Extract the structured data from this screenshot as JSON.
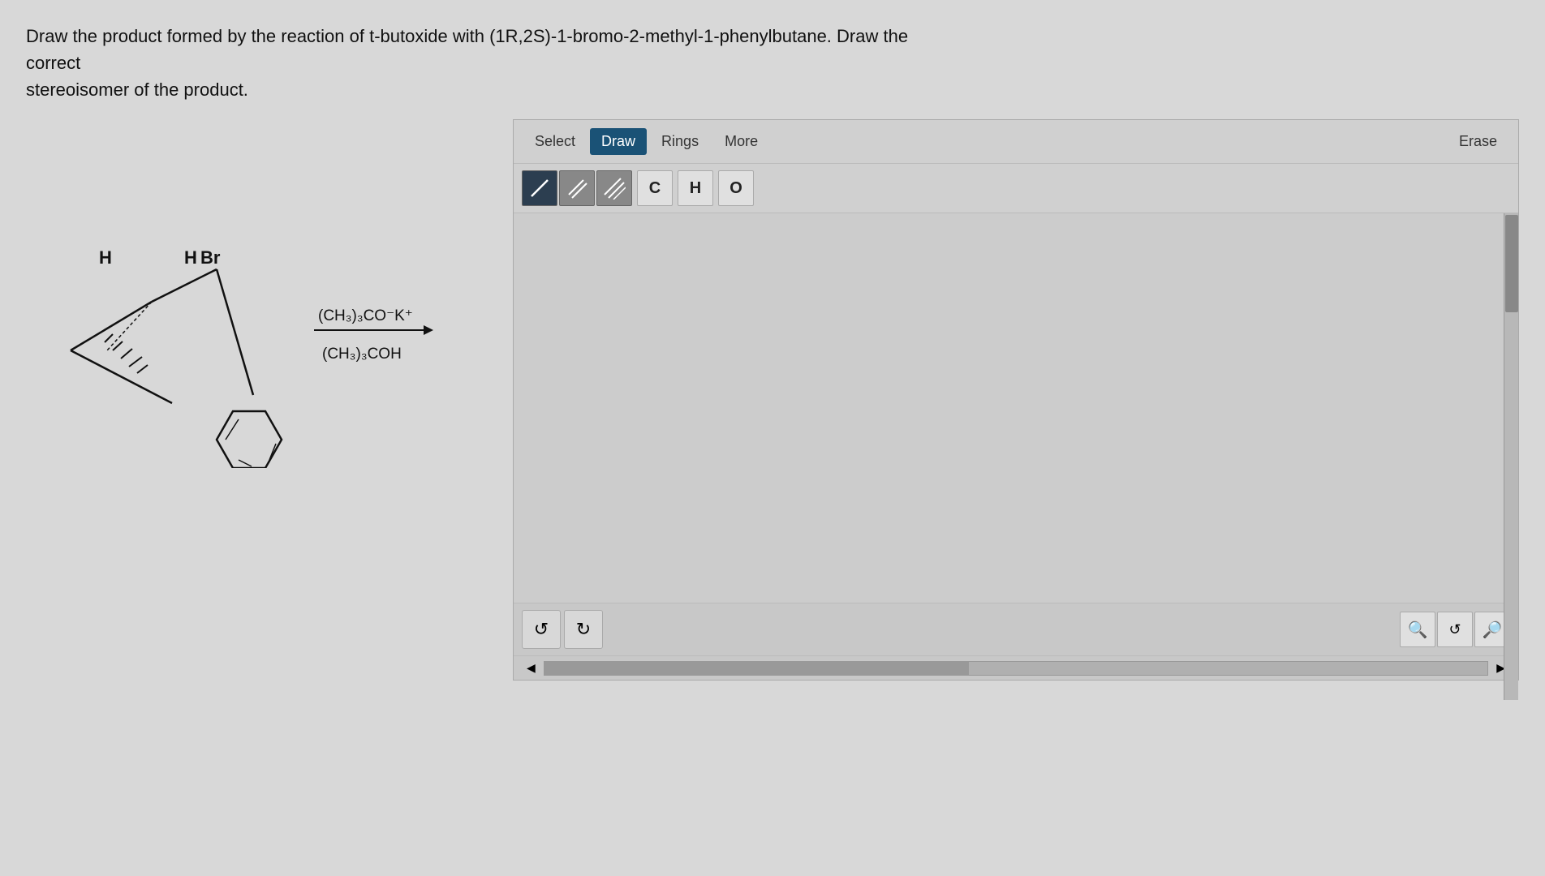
{
  "question": {
    "text": "Draw the product formed by the reaction of t-butoxide with (1R,2S)-1-bromo-2-methyl-1-phenylbutane. Draw the correct",
    "text2": "stereoisomer of the product."
  },
  "toolbar": {
    "select_label": "Select",
    "draw_label": "Draw",
    "rings_label": "Rings",
    "more_label": "More",
    "erase_label": "Erase"
  },
  "bond_buttons": [
    {
      "id": "single",
      "label": "/",
      "active": true
    },
    {
      "id": "double",
      "label": "//"
    },
    {
      "id": "triple",
      "label": "///"
    }
  ],
  "atom_buttons": [
    {
      "id": "carbon",
      "label": "C"
    },
    {
      "id": "hydrogen",
      "label": "H"
    },
    {
      "id": "oxygen",
      "label": "O"
    }
  ],
  "bottom_buttons": {
    "undo_label": "↺",
    "redo_label": "↻"
  },
  "zoom_buttons": {
    "zoom_in_label": "⊕",
    "reset_label": "⊘",
    "zoom_out_label": "⊖"
  },
  "reaction": {
    "reagent1": "(CH₃)₃CO⁻K⁺",
    "reagent2": "(CH₃)₃COH"
  },
  "colors": {
    "active_button_bg": "#1a5276",
    "panel_bg": "#c8c8c8",
    "bond_btn_active": "#2c3e50"
  }
}
